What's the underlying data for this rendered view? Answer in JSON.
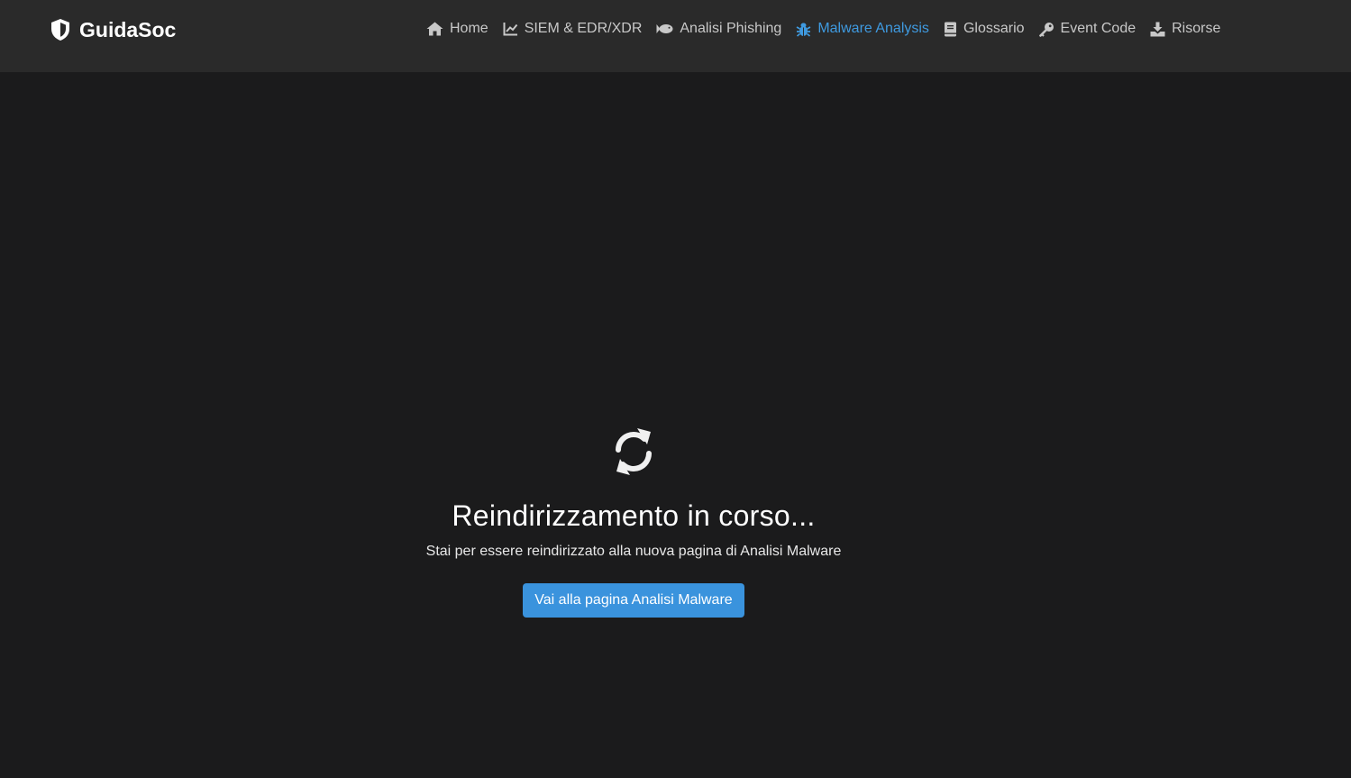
{
  "brand": {
    "name": "GuidaSoc",
    "icon": "shield-icon"
  },
  "nav": [
    {
      "label": "Home",
      "icon": "home-icon"
    },
    {
      "label": "SIEM & EDR/XDR",
      "icon": "line-chart-icon"
    },
    {
      "label": "Analisi Phishing",
      "icon": "fish-icon"
    },
    {
      "label": "Malware Analysis",
      "icon": "bug-icon",
      "active": true
    },
    {
      "label": "Glossario",
      "icon": "book-icon"
    },
    {
      "label": "Event Code",
      "icon": "key-icon"
    },
    {
      "label": "Risorse",
      "icon": "download-icon"
    }
  ],
  "redirect": {
    "icon": "sync-icon",
    "title": "Reindirizzamento in corso...",
    "message": "Stai per essere reindirizzato alla nuova pagina di Analisi Malware",
    "button_label": "Vai alla pagina Analisi Malware"
  },
  "colors": {
    "background": "#1b1b1c",
    "navbar": "#2a2a2a",
    "accent": "#3a93dd",
    "active_link": "#3f9ae0"
  }
}
